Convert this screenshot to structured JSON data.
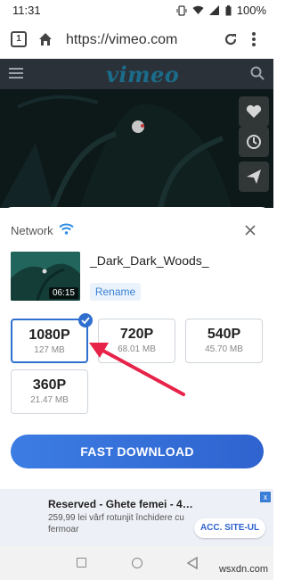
{
  "status": {
    "time": "11:31",
    "battery": "100%"
  },
  "browser": {
    "url": "https://vimeo.com",
    "tab_count": "1"
  },
  "site": {
    "logo": "vimeo"
  },
  "sheet": {
    "network_label": "Network",
    "video_title": "_Dark_Dark_Woods_",
    "duration": "06:15",
    "rename_label": "Rename",
    "qualities": [
      {
        "label": "1080P",
        "size": "127 MB",
        "selected": true
      },
      {
        "label": "720P",
        "size": "68.01 MB",
        "selected": false
      },
      {
        "label": "540P",
        "size": "45.70 MB",
        "selected": false
      },
      {
        "label": "360P",
        "size": "21.47 MB",
        "selected": false
      }
    ],
    "download_label": "FAST DOWNLOAD"
  },
  "ad": {
    "title": "Reserved - Ghete femei - 4…",
    "text": "259,99 lei vârf rotunjit închidere cu fermoar",
    "cta": "ACC. SITE-UL",
    "close": "x"
  },
  "watermark": "wsxdn.com",
  "colors": {
    "accent": "#2f6fd0",
    "arrow": "#e8234a",
    "header": "#2b3138"
  }
}
